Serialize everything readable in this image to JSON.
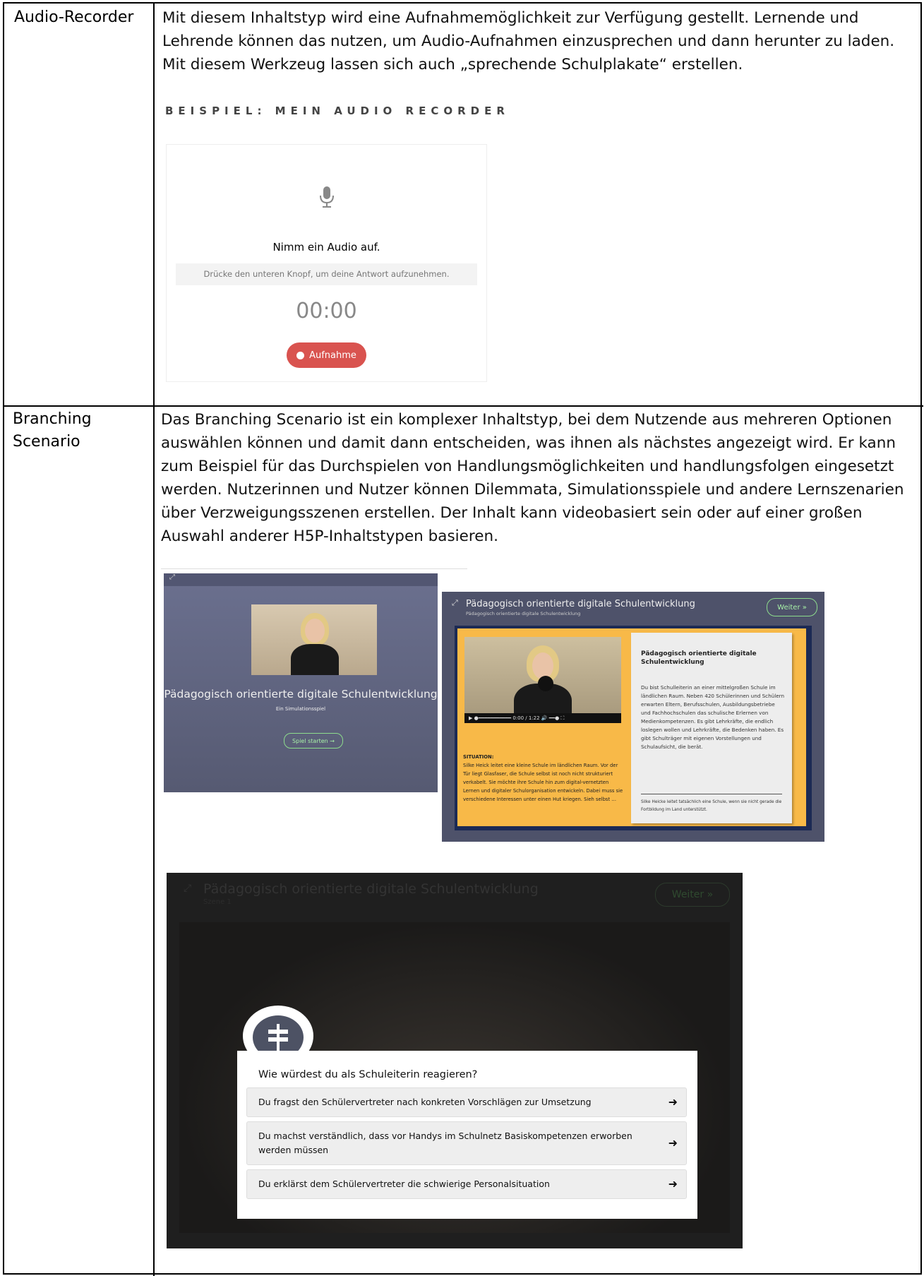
{
  "rows": [
    {
      "term": "Audio-Recorder",
      "description": "Mit diesem Inhaltstyp wird eine Aufnahmemöglichkeit zur Verfügung gestellt. Lernende und Lehrende können das nutzen, um Audio-Aufnahmen einzusprechen und dann herunter zu laden. Mit diesem Werkzeug lassen sich auch „sprechende Schulplakate“ erstellen."
    },
    {
      "term": "Branching Scenario",
      "description": "Das Branching Scenario ist ein komplexer Inhaltstyp, bei dem Nutzende aus mehreren Optionen auswählen können und damit dann entscheiden, was ihnen als nächstes angezeigt wird. Er kann zum Beispiel für das Durchspielen von Handlungsmöglichkeiten und handlungsfolgen eingesetzt werden. Nutzerinnen und Nutzer können Dilemmata, Simulationsspiele und andere Lernszenarien über Verzweigungsszenen erstellen. Der Inhalt kann videobasiert sein oder auf einer großen Auswahl anderer H5P-Inhaltstypen basieren."
    }
  ],
  "audio_example": {
    "heading": "BEISPIEL: MEIN AUDIO RECORDER",
    "title": "Nimm ein Audio auf.",
    "hint": "Drücke den unteren Knopf, um deine Antwort aufzunehmen.",
    "timer": "00:00",
    "record_label": "Aufnahme",
    "accent": "#d9534f"
  },
  "start_screen": {
    "title": "Pädagogisch orientierte digitale Schulentwicklung",
    "subtitle": "Ein Simulationsspiel",
    "start_label": "Spiel starten →"
  },
  "content_screen": {
    "title": "Pädagogisch orientierte digitale Schulentwicklung",
    "subtitle": "Pädagogisch orientierte digitale Schulentwicklung",
    "next_label": "Weiter »",
    "video_time": "0:00 / 1:22",
    "situation_heading": "SITUATION:",
    "situation_text": "Silke Heick leitet eine kleine Schule im ländlichen Raum. Vor der Tür liegt Glasfaser, die Schule selbst ist noch nicht strukturiert verkabelt. Sie möchte ihre Schule hin zum digital-vernetzten Lernen und digitaler Schulorganisation entwickeln. Dabei muss sie verschiedene Interessen unter einen Hut kriegen. Sieh selbst …",
    "card_heading": "Pädagogisch orientierte digitale Schulentwicklung",
    "card_text": "Du bist Schulleiterin an einer mittelgroßen Schule im ländlichen Raum. Neben 420 Schülerinnen und Schülern erwarten Eltern, Berufsschulen, Ausbildungsbetriebe und Fachhochschulen das schulische Erlernen von Medienkompetenzen. Es gibt Lehrkräfte, die endlich loslegen wollen und Lehrkräfte, die Bedenken haben. Es gibt Schulträger mit eigenen Vorstellungen und Schulaufsicht, die berät.",
    "card_footer": "Silke Heicke leitet tatsächlich eine Schule, wenn sie nicht gerade die Fortbildung im Land unterstützt."
  },
  "question_screen": {
    "title": "Pädagogisch orientierte digitale Schulentwicklung",
    "subtitle": "Szene 1",
    "next_label": "Weiter »",
    "question": "Wie würdest du als Schuleiterin reagieren?",
    "options": [
      "Du fragst den Schülervertreter nach konkreten Vorschlägen zur Umsetzung",
      "Du machst verständlich, dass vor Handys im Schulnetz Basiskompetenzen erworben werden müssen",
      "Du erklärst dem Schülervertreter die schwierige Personalsituation"
    ]
  }
}
